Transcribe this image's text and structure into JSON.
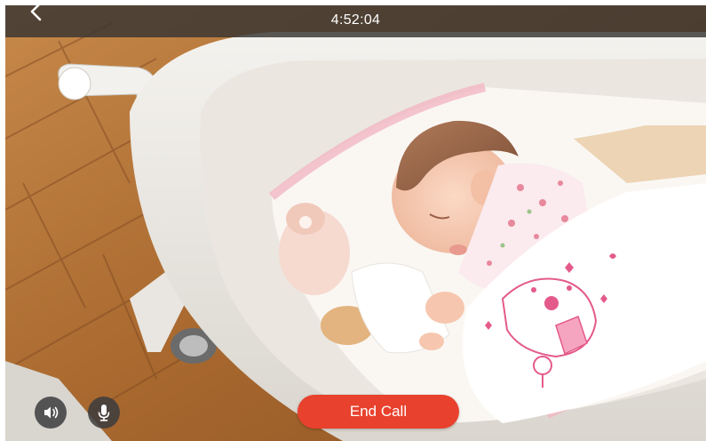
{
  "call": {
    "timer": "4:52:04",
    "end_call_label": "End Call"
  },
  "icons": {
    "back": "chevron-left-icon",
    "speaker": "speaker-icon",
    "microphone": "microphone-icon"
  },
  "colors": {
    "end_call": "#e8412d",
    "top_bar": "#373432",
    "control_button": "#3c3c3e"
  }
}
